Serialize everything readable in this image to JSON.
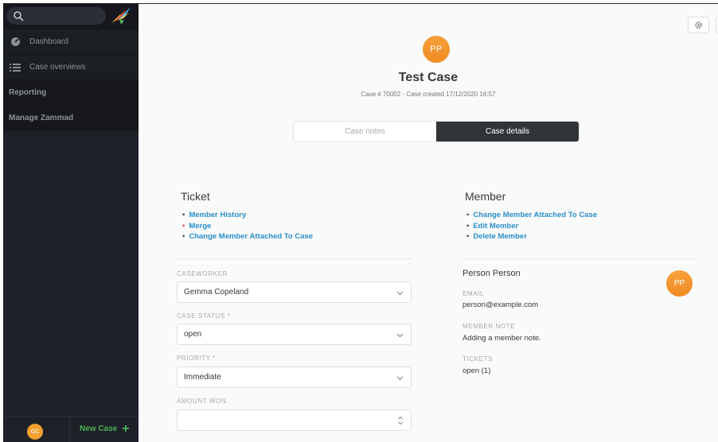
{
  "sidebar": {
    "search": {
      "placeholder": "",
      "value": ""
    },
    "items": [
      {
        "label": "Dashboard",
        "icon": "dashboard-icon"
      },
      {
        "label": "Case overviews",
        "icon": "list-icon"
      }
    ],
    "sections": [
      {
        "label": "Reporting"
      },
      {
        "label": "Manage Zammad"
      }
    ],
    "user_initials": "GC",
    "new_case_label": "New Case",
    "new_case_plus": "+"
  },
  "case": {
    "avatar_initials": "PP",
    "title": "Test Case",
    "subtitle": "Case # 70002 - Case created 17/12/2020 16:57"
  },
  "tabs": [
    {
      "label": "Case notes",
      "active": false
    },
    {
      "label": "Case details",
      "active": true
    }
  ],
  "ticket": {
    "heading": "Ticket",
    "links": [
      "Member History",
      "Merge",
      "Change Member Attached To Case"
    ]
  },
  "member": {
    "heading": "Member",
    "links": [
      "Change Member Attached To Case",
      "Edit Member",
      "Delete Member"
    ],
    "name": "Person Person",
    "avatar_initials": "PP",
    "email_label": "EMAIL",
    "email": "person@example.com",
    "note_label": "MEMBER NOTE",
    "note": "Adding a member note.",
    "tickets_label": "TICKETS",
    "tickets": "open (1)"
  },
  "form": {
    "caseworker_label": "CASEWORKER",
    "caseworker_value": "Gemma Copeland",
    "status_label": "CASE STATUS *",
    "status_value": "open",
    "priority_label": "PRIORITY *",
    "priority_value": "Immediate",
    "amount_label": "AMOUNT WON",
    "amount_value": ""
  },
  "colors": {
    "sidebar_bg": "#1e2127",
    "link": "#2a8fc9",
    "accent_green": "#4cb05b",
    "avatar_orange": "#f18a24",
    "active_tab": "#323538"
  }
}
